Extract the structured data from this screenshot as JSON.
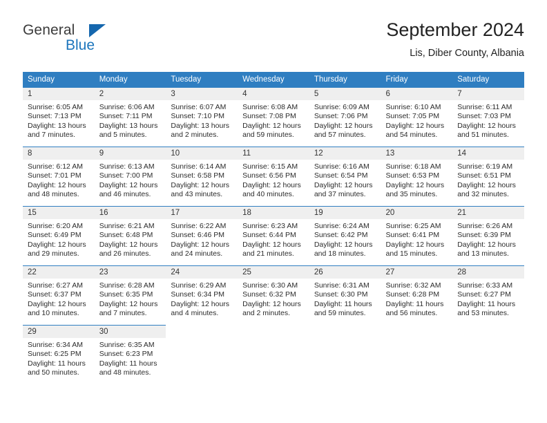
{
  "brand": {
    "name_part1": "General",
    "name_part2": "Blue",
    "flag_icon": "triangle-flag-icon",
    "accent_color": "#1c75bc"
  },
  "header": {
    "title": "September 2024",
    "subtitle": "Lis, Diber County, Albania"
  },
  "calendar": {
    "header_bg": "#2f7ec1",
    "daynum_bg": "#efefef",
    "weekdays": [
      "Sunday",
      "Monday",
      "Tuesday",
      "Wednesday",
      "Thursday",
      "Friday",
      "Saturday"
    ],
    "weeks": [
      [
        {
          "day": "1",
          "sunrise": "Sunrise: 6:05 AM",
          "sunset": "Sunset: 7:13 PM",
          "daylight_line1": "Daylight: 13 hours",
          "daylight_line2": "and 7 minutes."
        },
        {
          "day": "2",
          "sunrise": "Sunrise: 6:06 AM",
          "sunset": "Sunset: 7:11 PM",
          "daylight_line1": "Daylight: 13 hours",
          "daylight_line2": "and 5 minutes."
        },
        {
          "day": "3",
          "sunrise": "Sunrise: 6:07 AM",
          "sunset": "Sunset: 7:10 PM",
          "daylight_line1": "Daylight: 13 hours",
          "daylight_line2": "and 2 minutes."
        },
        {
          "day": "4",
          "sunrise": "Sunrise: 6:08 AM",
          "sunset": "Sunset: 7:08 PM",
          "daylight_line1": "Daylight: 12 hours",
          "daylight_line2": "and 59 minutes."
        },
        {
          "day": "5",
          "sunrise": "Sunrise: 6:09 AM",
          "sunset": "Sunset: 7:06 PM",
          "daylight_line1": "Daylight: 12 hours",
          "daylight_line2": "and 57 minutes."
        },
        {
          "day": "6",
          "sunrise": "Sunrise: 6:10 AM",
          "sunset": "Sunset: 7:05 PM",
          "daylight_line1": "Daylight: 12 hours",
          "daylight_line2": "and 54 minutes."
        },
        {
          "day": "7",
          "sunrise": "Sunrise: 6:11 AM",
          "sunset": "Sunset: 7:03 PM",
          "daylight_line1": "Daylight: 12 hours",
          "daylight_line2": "and 51 minutes."
        }
      ],
      [
        {
          "day": "8",
          "sunrise": "Sunrise: 6:12 AM",
          "sunset": "Sunset: 7:01 PM",
          "daylight_line1": "Daylight: 12 hours",
          "daylight_line2": "and 48 minutes."
        },
        {
          "day": "9",
          "sunrise": "Sunrise: 6:13 AM",
          "sunset": "Sunset: 7:00 PM",
          "daylight_line1": "Daylight: 12 hours",
          "daylight_line2": "and 46 minutes."
        },
        {
          "day": "10",
          "sunrise": "Sunrise: 6:14 AM",
          "sunset": "Sunset: 6:58 PM",
          "daylight_line1": "Daylight: 12 hours",
          "daylight_line2": "and 43 minutes."
        },
        {
          "day": "11",
          "sunrise": "Sunrise: 6:15 AM",
          "sunset": "Sunset: 6:56 PM",
          "daylight_line1": "Daylight: 12 hours",
          "daylight_line2": "and 40 minutes."
        },
        {
          "day": "12",
          "sunrise": "Sunrise: 6:16 AM",
          "sunset": "Sunset: 6:54 PM",
          "daylight_line1": "Daylight: 12 hours",
          "daylight_line2": "and 37 minutes."
        },
        {
          "day": "13",
          "sunrise": "Sunrise: 6:18 AM",
          "sunset": "Sunset: 6:53 PM",
          "daylight_line1": "Daylight: 12 hours",
          "daylight_line2": "and 35 minutes."
        },
        {
          "day": "14",
          "sunrise": "Sunrise: 6:19 AM",
          "sunset": "Sunset: 6:51 PM",
          "daylight_line1": "Daylight: 12 hours",
          "daylight_line2": "and 32 minutes."
        }
      ],
      [
        {
          "day": "15",
          "sunrise": "Sunrise: 6:20 AM",
          "sunset": "Sunset: 6:49 PM",
          "daylight_line1": "Daylight: 12 hours",
          "daylight_line2": "and 29 minutes."
        },
        {
          "day": "16",
          "sunrise": "Sunrise: 6:21 AM",
          "sunset": "Sunset: 6:48 PM",
          "daylight_line1": "Daylight: 12 hours",
          "daylight_line2": "and 26 minutes."
        },
        {
          "day": "17",
          "sunrise": "Sunrise: 6:22 AM",
          "sunset": "Sunset: 6:46 PM",
          "daylight_line1": "Daylight: 12 hours",
          "daylight_line2": "and 24 minutes."
        },
        {
          "day": "18",
          "sunrise": "Sunrise: 6:23 AM",
          "sunset": "Sunset: 6:44 PM",
          "daylight_line1": "Daylight: 12 hours",
          "daylight_line2": "and 21 minutes."
        },
        {
          "day": "19",
          "sunrise": "Sunrise: 6:24 AM",
          "sunset": "Sunset: 6:42 PM",
          "daylight_line1": "Daylight: 12 hours",
          "daylight_line2": "and 18 minutes."
        },
        {
          "day": "20",
          "sunrise": "Sunrise: 6:25 AM",
          "sunset": "Sunset: 6:41 PM",
          "daylight_line1": "Daylight: 12 hours",
          "daylight_line2": "and 15 minutes."
        },
        {
          "day": "21",
          "sunrise": "Sunrise: 6:26 AM",
          "sunset": "Sunset: 6:39 PM",
          "daylight_line1": "Daylight: 12 hours",
          "daylight_line2": "and 13 minutes."
        }
      ],
      [
        {
          "day": "22",
          "sunrise": "Sunrise: 6:27 AM",
          "sunset": "Sunset: 6:37 PM",
          "daylight_line1": "Daylight: 12 hours",
          "daylight_line2": "and 10 minutes."
        },
        {
          "day": "23",
          "sunrise": "Sunrise: 6:28 AM",
          "sunset": "Sunset: 6:35 PM",
          "daylight_line1": "Daylight: 12 hours",
          "daylight_line2": "and 7 minutes."
        },
        {
          "day": "24",
          "sunrise": "Sunrise: 6:29 AM",
          "sunset": "Sunset: 6:34 PM",
          "daylight_line1": "Daylight: 12 hours",
          "daylight_line2": "and 4 minutes."
        },
        {
          "day": "25",
          "sunrise": "Sunrise: 6:30 AM",
          "sunset": "Sunset: 6:32 PM",
          "daylight_line1": "Daylight: 12 hours",
          "daylight_line2": "and 2 minutes."
        },
        {
          "day": "26",
          "sunrise": "Sunrise: 6:31 AM",
          "sunset": "Sunset: 6:30 PM",
          "daylight_line1": "Daylight: 11 hours",
          "daylight_line2": "and 59 minutes."
        },
        {
          "day": "27",
          "sunrise": "Sunrise: 6:32 AM",
          "sunset": "Sunset: 6:28 PM",
          "daylight_line1": "Daylight: 11 hours",
          "daylight_line2": "and 56 minutes."
        },
        {
          "day": "28",
          "sunrise": "Sunrise: 6:33 AM",
          "sunset": "Sunset: 6:27 PM",
          "daylight_line1": "Daylight: 11 hours",
          "daylight_line2": "and 53 minutes."
        }
      ],
      [
        {
          "day": "29",
          "sunrise": "Sunrise: 6:34 AM",
          "sunset": "Sunset: 6:25 PM",
          "daylight_line1": "Daylight: 11 hours",
          "daylight_line2": "and 50 minutes."
        },
        {
          "day": "30",
          "sunrise": "Sunrise: 6:35 AM",
          "sunset": "Sunset: 6:23 PM",
          "daylight_line1": "Daylight: 11 hours",
          "daylight_line2": "and 48 minutes."
        },
        {
          "day": "",
          "sunrise": "",
          "sunset": "",
          "daylight_line1": "",
          "daylight_line2": ""
        },
        {
          "day": "",
          "sunrise": "",
          "sunset": "",
          "daylight_line1": "",
          "daylight_line2": ""
        },
        {
          "day": "",
          "sunrise": "",
          "sunset": "",
          "daylight_line1": "",
          "daylight_line2": ""
        },
        {
          "day": "",
          "sunrise": "",
          "sunset": "",
          "daylight_line1": "",
          "daylight_line2": ""
        },
        {
          "day": "",
          "sunrise": "",
          "sunset": "",
          "daylight_line1": "",
          "daylight_line2": ""
        }
      ]
    ]
  }
}
